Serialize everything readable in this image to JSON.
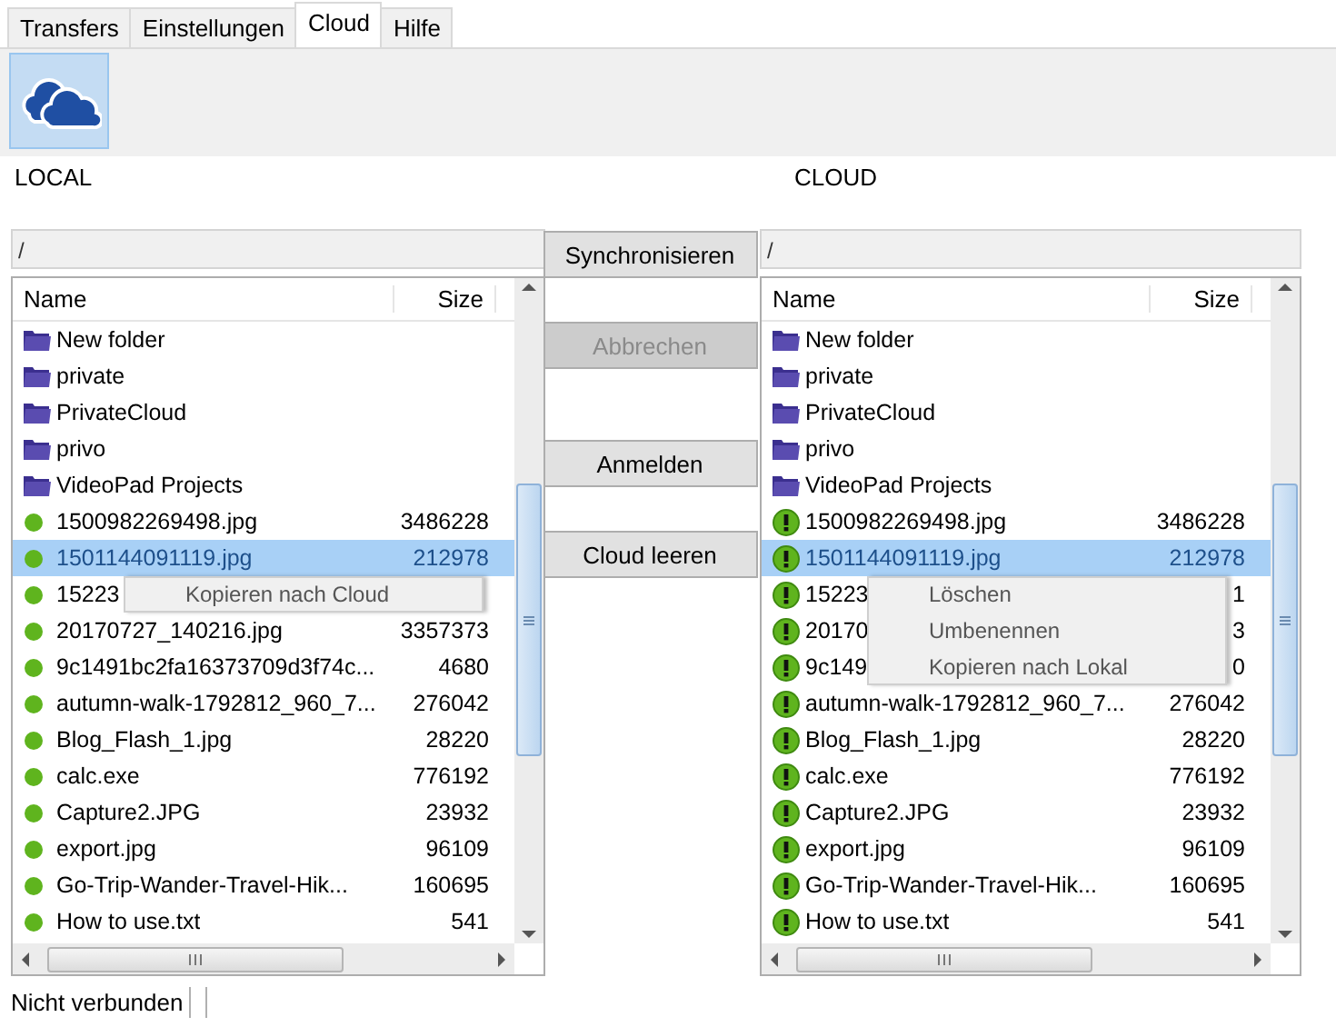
{
  "tabs": [
    {
      "label": "Transfers",
      "selected": false
    },
    {
      "label": "Einstellungen",
      "selected": false
    },
    {
      "label": "Cloud",
      "selected": true
    },
    {
      "label": "Hilfe",
      "selected": false
    }
  ],
  "local": {
    "title": "LOCAL",
    "path": "/",
    "columns": [
      "Name",
      "Size"
    ],
    "rows": [
      {
        "kind": "folder",
        "name": "New folder",
        "selected": false
      },
      {
        "kind": "folder",
        "name": "private",
        "selected": false
      },
      {
        "kind": "folder",
        "name": "PrivateCloud",
        "selected": false
      },
      {
        "kind": "folder",
        "name": "privo",
        "selected": false
      },
      {
        "kind": "folder",
        "name": "VideoPad Projects",
        "selected": false
      },
      {
        "kind": "ok",
        "name": "1500982269498.jpg",
        "size": "3486228",
        "selected": false
      },
      {
        "kind": "ok",
        "name": "1501144091119.jpg",
        "size": "212978",
        "selected": true
      },
      {
        "kind": "ok",
        "name": "15223",
        "selected": false
      },
      {
        "kind": "ok",
        "name": "20170727_140216.jpg",
        "size": "3357373",
        "selected": false
      },
      {
        "kind": "ok",
        "name": "9c1491bc2fa16373709d3f74c...",
        "size": "4680",
        "selected": false
      },
      {
        "kind": "ok",
        "name": "autumn-walk-1792812_960_7...",
        "size": "276042",
        "selected": false
      },
      {
        "kind": "ok",
        "name": "Blog_Flash_1.jpg",
        "size": "28220",
        "selected": false
      },
      {
        "kind": "ok",
        "name": "calc.exe",
        "size": "776192",
        "selected": false
      },
      {
        "kind": "ok",
        "name": "Capture2.JPG",
        "size": "23932",
        "selected": false
      },
      {
        "kind": "ok",
        "name": "export.jpg",
        "size": "96109",
        "selected": false
      },
      {
        "kind": "ok",
        "name": "Go-Trip-Wander-Travel-Hik...",
        "size": "160695",
        "selected": false
      },
      {
        "kind": "ok",
        "name": "How to use.txt",
        "size": "541",
        "selected": false
      }
    ],
    "context_menu": [
      "Kopieren nach Cloud"
    ]
  },
  "buttons": [
    {
      "label": "Synchronisieren",
      "disabled": false
    },
    {
      "label": "Abbrechen",
      "disabled": true
    },
    {
      "label": "Anmelden",
      "disabled": false
    },
    {
      "label": "Cloud leeren",
      "disabled": false
    }
  ],
  "cloud": {
    "title": "CLOUD",
    "path": "/",
    "columns": [
      "Name",
      "Size"
    ],
    "rows": [
      {
        "kind": "folder",
        "name": "New folder",
        "selected": false
      },
      {
        "kind": "folder",
        "name": "private",
        "selected": false
      },
      {
        "kind": "folder",
        "name": "PrivateCloud",
        "selected": false
      },
      {
        "kind": "folder",
        "name": "privo",
        "selected": false
      },
      {
        "kind": "folder",
        "name": "VideoPad Projects",
        "selected": false
      },
      {
        "kind": "warning",
        "name": "1500982269498.jpg",
        "size": "3486228",
        "selected": false
      },
      {
        "kind": "warning",
        "name": "1501144091119.jpg",
        "size": "212978",
        "selected": true
      },
      {
        "kind": "warning",
        "name": "15223",
        "size": "1",
        "selected": false
      },
      {
        "kind": "warning",
        "name": "20170",
        "size": "3",
        "selected": false
      },
      {
        "kind": "warning",
        "name": "9c149",
        "size": "0",
        "selected": false
      },
      {
        "kind": "warning",
        "name": "autumn-walk-1792812_960_7...",
        "size": "276042",
        "selected": false
      },
      {
        "kind": "warning",
        "name": "Blog_Flash_1.jpg",
        "size": "28220",
        "selected": false
      },
      {
        "kind": "warning",
        "name": "calc.exe",
        "size": "776192",
        "selected": false
      },
      {
        "kind": "warning",
        "name": "Capture2.JPG",
        "size": "23932",
        "selected": false
      },
      {
        "kind": "warning",
        "name": "export.jpg",
        "size": "96109",
        "selected": false
      },
      {
        "kind": "warning",
        "name": "Go-Trip-Wander-Travel-Hik...",
        "size": "160695",
        "selected": false
      },
      {
        "kind": "warning",
        "name": "How to use.txt",
        "size": "541",
        "selected": false
      }
    ],
    "context_menu": [
      "Löschen",
      "Umbenennen",
      "Kopieren nach Lokal"
    ]
  },
  "status_bar": {
    "text": "Nicht verbunden"
  }
}
